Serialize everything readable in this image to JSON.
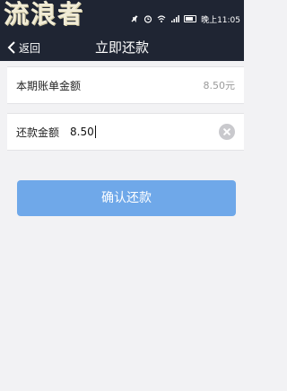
{
  "status_bar": {
    "watermark": "流浪者",
    "time": "晚上11:05"
  },
  "navbar": {
    "back_label": "返回",
    "title": "立即还款"
  },
  "bill": {
    "label": "本期账单金额",
    "value": "8.50元"
  },
  "repay": {
    "label": "还款金额",
    "value": "8.50"
  },
  "confirm_label": "确认还款",
  "colors": {
    "header": "#1f2533",
    "button": "#6fa8e9",
    "background": "#f2f2f4"
  }
}
